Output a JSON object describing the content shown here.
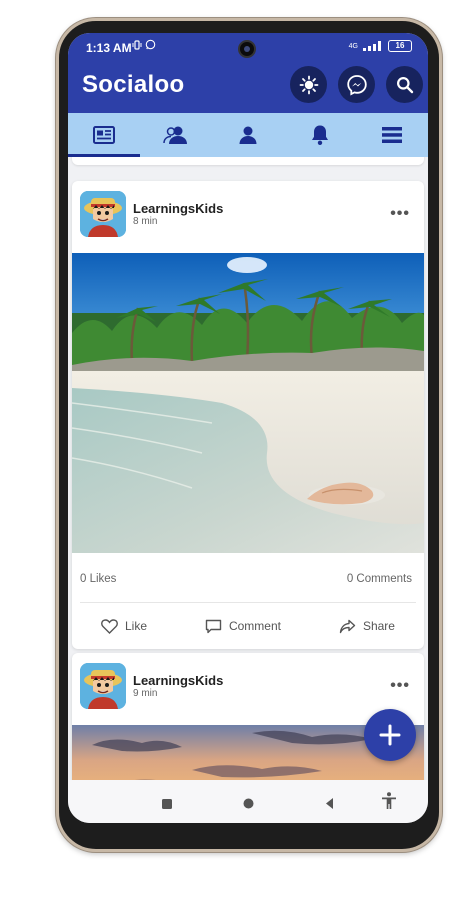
{
  "status_bar": {
    "time": "1:13 AM",
    "notification_icons": [
      "vibrate-icon",
      "whatsapp-icon"
    ],
    "network": "4G",
    "battery": "16"
  },
  "app": {
    "title": "Socialoo",
    "accent_color": "#2d40a8",
    "tab_bar_color": "#a8d0f3",
    "header_buttons": [
      "brightness-icon",
      "messenger-icon",
      "search-icon"
    ]
  },
  "tabs": [
    {
      "icon": "news-feed-icon",
      "active": true
    },
    {
      "icon": "friends-icon",
      "active": false
    },
    {
      "icon": "profile-icon",
      "active": false
    },
    {
      "icon": "bell-icon",
      "active": false
    },
    {
      "icon": "menu-icon",
      "active": false
    }
  ],
  "posts": [
    {
      "author": "LearningsKids",
      "time": "8 min",
      "likes": "0 Likes",
      "comments": "0 Comments",
      "actions": {
        "like": "Like",
        "comment": "Comment",
        "share": "Share"
      }
    },
    {
      "author": "LearningsKids",
      "time": "9 min"
    }
  ],
  "fab_icon": "plus-icon",
  "nav_buttons": [
    "recents-icon",
    "home-icon",
    "back-icon",
    "accessibility-icon"
  ]
}
